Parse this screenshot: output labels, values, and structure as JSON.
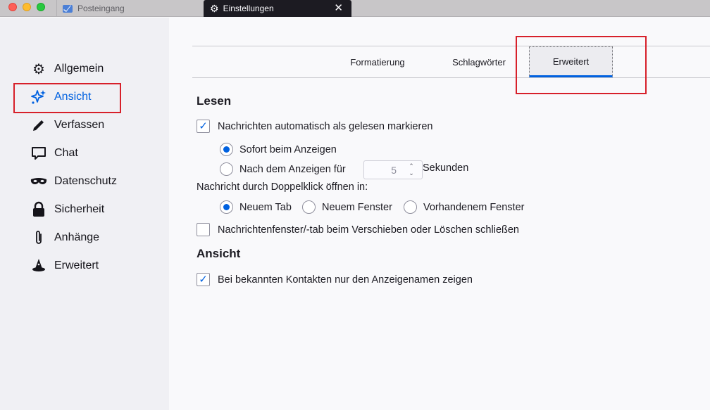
{
  "window": {
    "tabs": [
      {
        "label": "Posteingang",
        "icon": "mail-icon"
      },
      {
        "label": "Einstellungen",
        "icon": "gear-icon"
      }
    ],
    "close_glyph": "✕"
  },
  "sidebar": {
    "items": [
      {
        "label": "Allgemein",
        "icon": "gear-icon"
      },
      {
        "label": "Ansicht",
        "icon": "sparkle-icon",
        "active": true
      },
      {
        "label": "Verfassen",
        "icon": "pencil-icon"
      },
      {
        "label": "Chat",
        "icon": "chat-bubble-icon"
      },
      {
        "label": "Datenschutz",
        "icon": "mask-icon"
      },
      {
        "label": "Sicherheit",
        "icon": "lock-icon"
      },
      {
        "label": "Anhänge",
        "icon": "paperclip-icon"
      },
      {
        "label": "Erweitert",
        "icon": "wizard-hat-icon"
      }
    ]
  },
  "pane_tabs": {
    "items": [
      "Formatierung",
      "Schlagwörter",
      "Erweitert"
    ],
    "selected": "Erweitert"
  },
  "lesen": {
    "heading": "Lesen",
    "auto_mark_label": "Nachrichten automatisch als gelesen markieren",
    "auto_mark_checked": true,
    "immediately_label": "Sofort beim Anzeigen",
    "after_label": "Nach dem Anzeigen für",
    "delay_value": "5",
    "delay_unit": "Sekunden",
    "doubleclick_label": "Nachricht durch Doppelklick öffnen in:",
    "open_options": [
      "Neuem Tab",
      "Neuem Fenster",
      "Vorhandenem Fenster"
    ],
    "open_selected": "Neuem Tab",
    "close_on_move_label": "Nachrichtenfenster/-tab beim Verschieben oder Löschen schließen",
    "close_on_move_checked": false
  },
  "ansicht": {
    "heading": "Ansicht",
    "display_names_label": "Bei bekannten Kontakten nur den Anzeigenamen zeigen",
    "display_names_checked": true
  },
  "colors": {
    "accent": "#0061e0",
    "annotation_red": "#d7202a"
  }
}
